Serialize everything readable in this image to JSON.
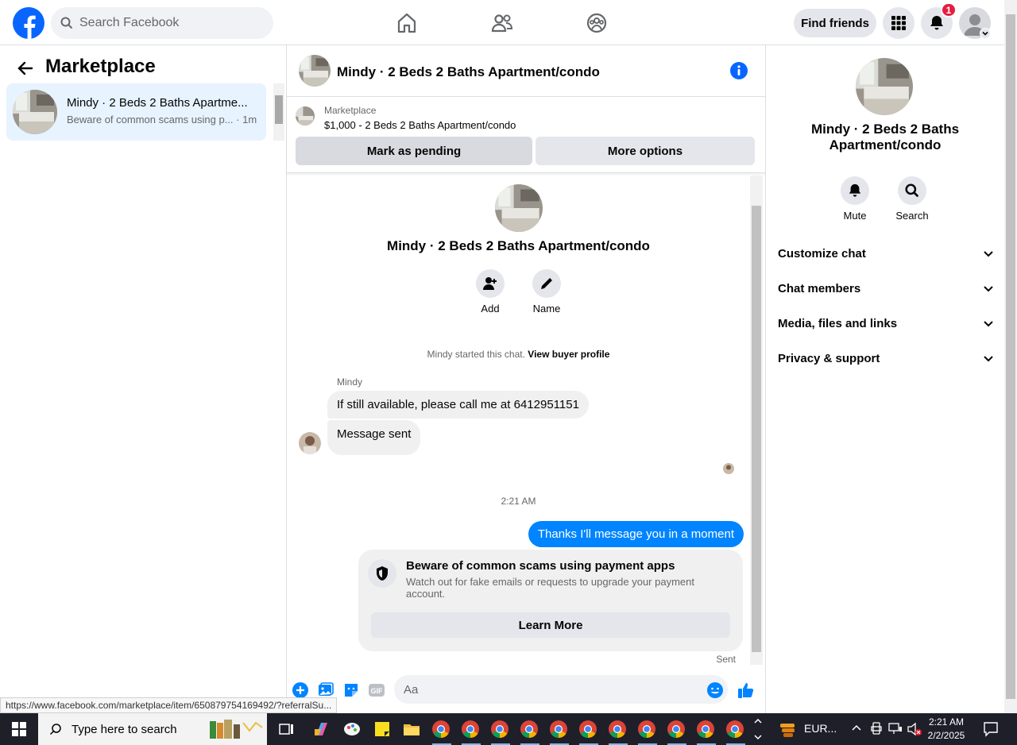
{
  "topbar": {
    "search_placeholder": "Search Facebook",
    "find_friends": "Find friends",
    "notification_count": "1"
  },
  "left": {
    "title": "Marketplace",
    "conversation": {
      "name": "Mindy · 2 Beds 2 Baths Apartme...",
      "preview": "Beware of common scams using p... · 1m"
    }
  },
  "status_url": "https://www.facebook.com/marketplace/item/650879754169492/?referralSu...",
  "chat": {
    "header_title": "Mindy · 2 Beds 2 Baths Apartment/condo",
    "listing": {
      "category": "Marketplace",
      "line": "$1,000 - 2 Beds 2 Baths Apartment/condo",
      "mark_pending": "Mark as pending",
      "more_options": "More options"
    },
    "intro": {
      "title": "Mindy · 2 Beds 2 Baths Apartment/condo",
      "add_label": "Add",
      "name_label": "Name",
      "started_text": "Mindy started this chat.",
      "view_profile": "View buyer profile"
    },
    "sender_name": "Mindy",
    "messages_in": [
      "If still available, please call me at 6412951151",
      "Message sent"
    ],
    "timestamp": "2:21 AM",
    "message_out": "Thanks I'll message you in a moment",
    "scam_card": {
      "title": "Beware of common scams using payment apps",
      "desc": "Watch out for fake emails or requests to upgrade your payment account.",
      "button": "Learn More"
    },
    "sent_label": "Sent",
    "composer_placeholder": "Aa"
  },
  "right": {
    "title": "Mindy · 2 Beds 2 Baths Apartment/condo",
    "mute": "Mute",
    "search": "Search",
    "sections": [
      "Customize chat",
      "Chat members",
      "Media, files and links",
      "Privacy & support"
    ]
  },
  "taskbar": {
    "search_placeholder": "Type here to search",
    "weather": "EUR...",
    "time": "2:21 AM",
    "date": "2/2/2025"
  },
  "colors": {
    "brand": "#0866ff",
    "messenger_blue": "#0084ff",
    "badge_red": "#e41e3f"
  }
}
